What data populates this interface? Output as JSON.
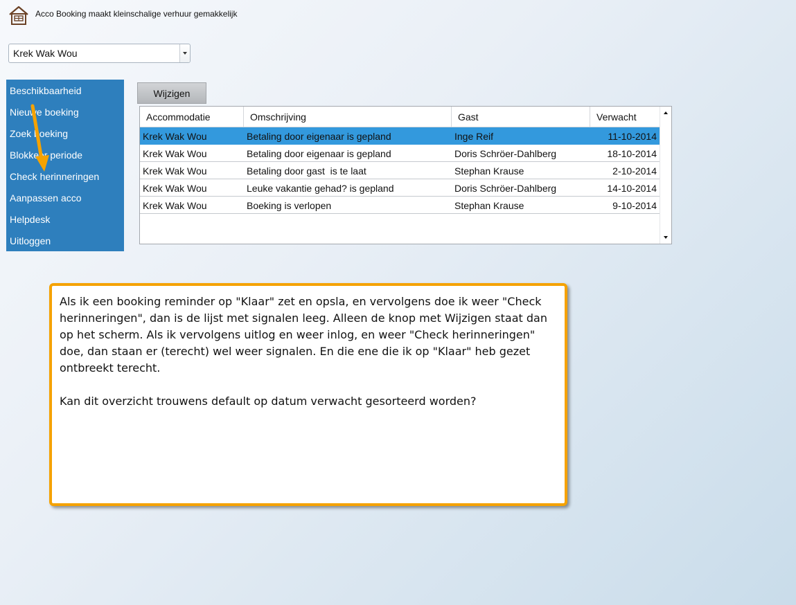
{
  "header": {
    "title": "Acco Booking maakt kleinschalige verhuur gemakkelijk",
    "logo_icon": "house-icon"
  },
  "accommodation_select": {
    "value": "Krek Wak Wou"
  },
  "sidebar": {
    "items": [
      {
        "label": "Beschikbaarheid"
      },
      {
        "label": "Nieuwe boeking"
      },
      {
        "label": "Zoek boeking"
      },
      {
        "label": "Blokkeer periode"
      },
      {
        "label": "Check herinneringen"
      },
      {
        "label": "Aanpassen acco"
      },
      {
        "label": "Helpdesk"
      },
      {
        "label": "Uitloggen"
      }
    ]
  },
  "toolbar": {
    "wijzigen_label": "Wijzigen"
  },
  "table": {
    "columns": [
      "Accommodatie",
      "Omschrijving",
      "Gast",
      "Verwacht"
    ],
    "selected_row": 0,
    "rows": [
      [
        "Krek Wak Wou",
        "Betaling door eigenaar is gepland",
        "Inge Reif",
        "11-10-2014"
      ],
      [
        "Krek Wak Wou",
        "Betaling door eigenaar is gepland",
        "Doris Schröer-Dahlberg",
        "18-10-2014"
      ],
      [
        "Krek Wak Wou",
        "Betaling door gast  is te laat",
        "Stephan Krause",
        "2-10-2014"
      ],
      [
        "Krek Wak Wou",
        "Leuke vakantie gehad? is gepland",
        "Doris Schröer-Dahlberg",
        "14-10-2014"
      ],
      [
        "Krek Wak Wou",
        "Boeking is verlopen",
        "Stephan Krause",
        "9-10-2014"
      ]
    ]
  },
  "annotation": {
    "paragraphs": [
      "Als ik een booking reminder op \"Klaar\" zet en opsla, en vervolgens doe ik weer \"Check herinneringen\", dan is de lijst met signalen leeg. Alleen de knop met Wijzigen staat dan op het scherm. Als ik vervolgens uitlog en weer inlog, en weer \"Check herinneringen\" doe, dan staan er (terecht)  wel weer signalen. En die ene die ik op \"Klaar\" heb gezet ontbreekt terecht.",
      "Kan dit overzicht trouwens default op datum verwacht gesorteerd worden?"
    ],
    "border_color": "#f5a200",
    "arrow_color": "#f5a200"
  },
  "colors": {
    "sidebar": "#2e7fbd",
    "selected_row": "#3399dd"
  }
}
